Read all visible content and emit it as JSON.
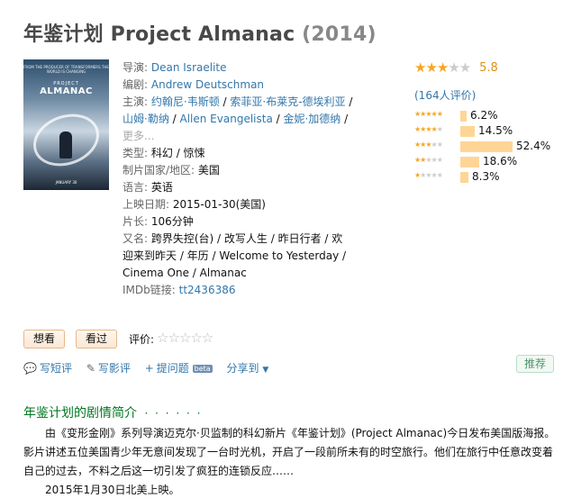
{
  "header": {
    "title": "年鉴计划 Project Almanac",
    "year": "(2014)"
  },
  "poster": {
    "top_text": "FROM THE PRODUCER OF TRANSFORMERS THE WORLD IS CHANGING",
    "title_small": "PROJECT",
    "title": "ALMANAC",
    "date": "JANUARY 30"
  },
  "info": {
    "director_label": "导演:",
    "director": "Dean Israelite",
    "writer_label": "编剧:",
    "writer": "Andrew Deutschman",
    "cast_label": "主演:",
    "cast": [
      "约翰尼·韦斯顿",
      "索菲亚·布莱克-德埃利亚",
      "山姆·勒纳",
      "Allen Evangelista",
      "金妮·加德纳"
    ],
    "cast_more": "更多...",
    "genre_label": "类型:",
    "genre": "科幻 / 惊悚",
    "country_label": "制片国家/地区:",
    "country": "美国",
    "language_label": "语言:",
    "language": "英语",
    "release_label": "上映日期:",
    "release": "2015-01-30(美国)",
    "runtime_label": "片长:",
    "runtime": "106分钟",
    "aka_label": "又名:",
    "aka": "跨界失控(台) / 改写人生 / 昨日行者 / 欢迎来到昨天 / 年历 / Welcome to Yesterday / Cinema One / Almanac",
    "imdb_label": "IMDb链接:",
    "imdb": "tt2436386"
  },
  "rating": {
    "score": "5.8",
    "stars": 3,
    "votes_text": "(164人评价)",
    "breakdown": [
      {
        "stars": 5,
        "pct": "6.2%",
        "value": 6.2
      },
      {
        "stars": 4,
        "pct": "14.5%",
        "value": 14.5
      },
      {
        "stars": 3,
        "pct": "52.4%",
        "value": 52.4
      },
      {
        "stars": 2,
        "pct": "18.6%",
        "value": 18.6
      },
      {
        "stars": 1,
        "pct": "8.3%",
        "value": 8.3
      }
    ]
  },
  "user_actions": {
    "want_label": "想看",
    "seen_label": "看过",
    "rate_label": "评价:"
  },
  "actions": {
    "write_comment": "写短评",
    "write_review": "写影评",
    "ask": "提问题",
    "beta": "beta",
    "share": "分享到",
    "recommend": "推荐"
  },
  "summary": {
    "title": "年鉴计划的剧情简介",
    "dots": "· · · · · ·",
    "paragraph": "由《变形金刚》系列导演迈克尔·贝监制的科幻新片《年鉴计划》(Project Almanac)今日发布美国版海报。影片讲述五位美国青少年无意间发现了一台时光机，开启了一段前所未有的时空旅行。他们在旅行中任意改变着自己的过去，不料之后这一切引发了疯狂的连锁反应……",
    "release_note": "2015年1月30日北美上映。"
  },
  "colors": {
    "link": "#3377aa",
    "star": "#f5a623",
    "bar": "#ffd596",
    "section_title": "#007722"
  }
}
